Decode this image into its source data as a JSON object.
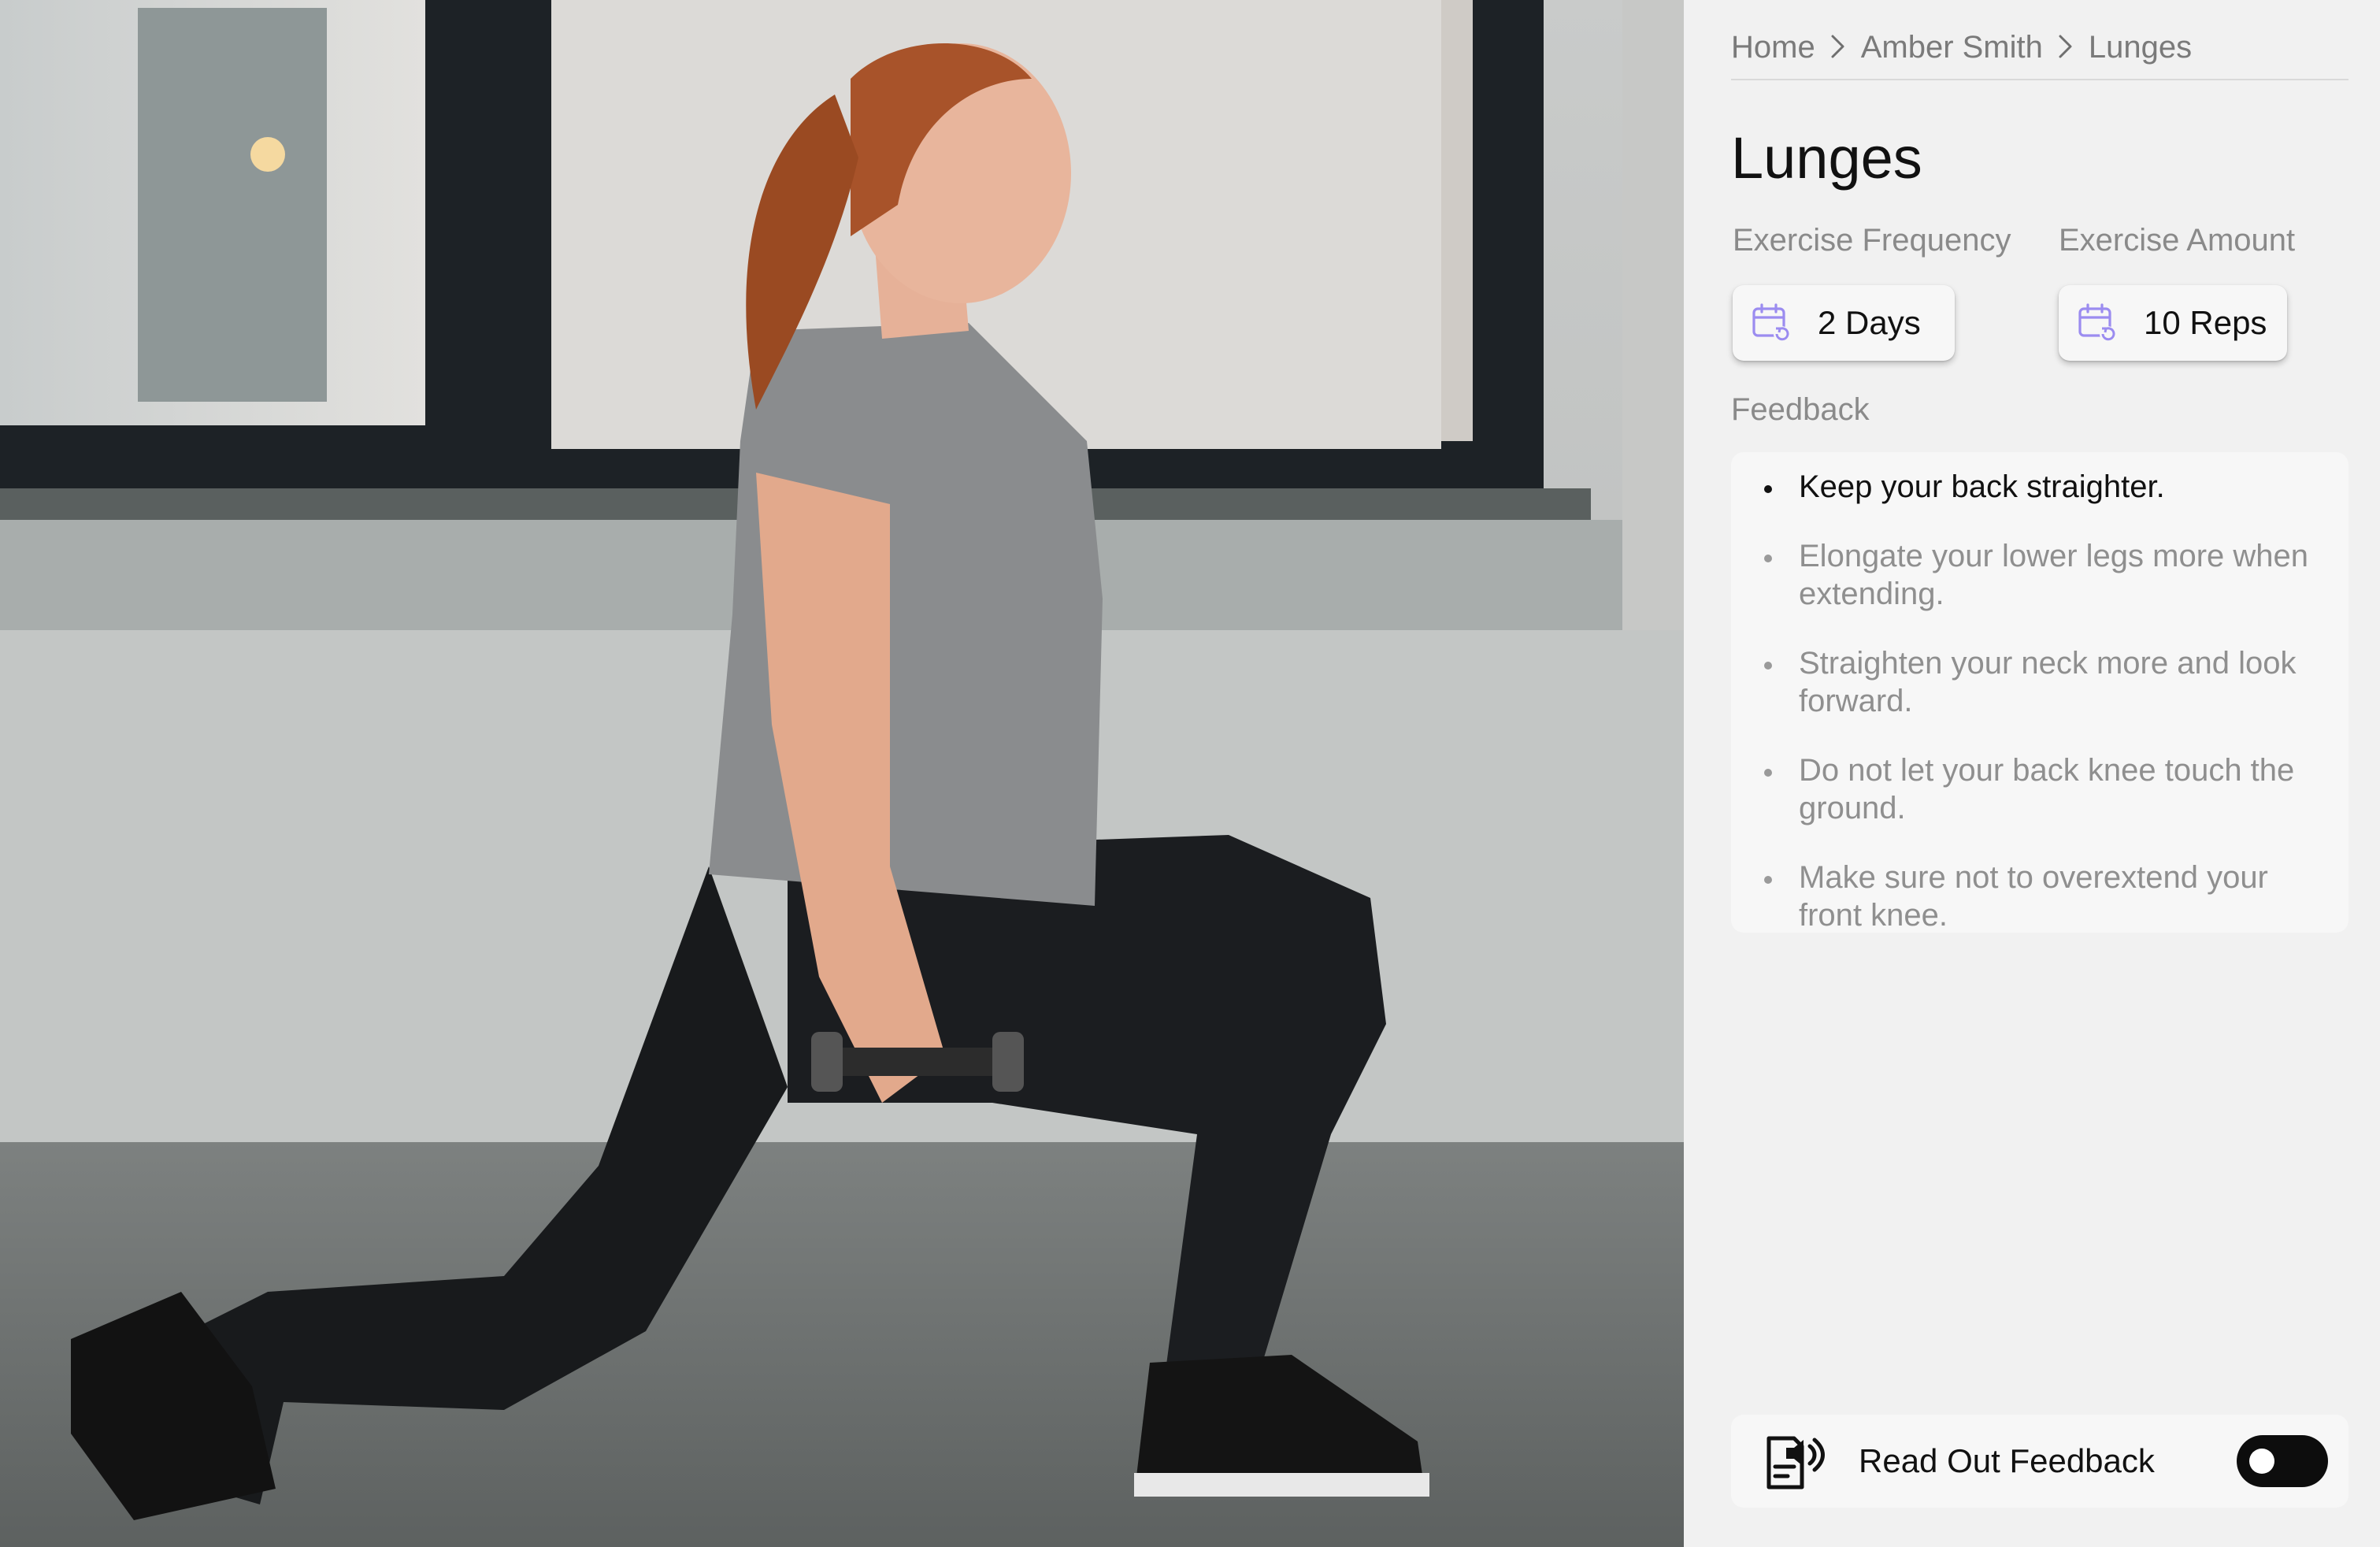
{
  "breadcrumb": {
    "items": [
      "Home",
      "Amber Smith",
      "Lunges"
    ]
  },
  "exercise": {
    "title": "Lunges",
    "frequency_label": "Exercise Frequency",
    "frequency_value": "2 Days",
    "amount_label": "Exercise Amount",
    "amount_value": "10 Reps"
  },
  "feedback": {
    "label": "Feedback",
    "items": [
      "Keep your back straighter.",
      "Elongate your lower legs more when extending.",
      "Straighten your neck more and look forward.",
      "Do not let your back knee touch the ground.",
      "Make sure not to overextend your front knee."
    ]
  },
  "readout": {
    "label": "Read Out Feedback",
    "toggle_on": false
  },
  "colors": {
    "accent_icon": "#9b8cf0",
    "panel_bg": "#f1f1f1",
    "card_bg": "#f7f7f7",
    "toggle_bg": "#0d0d0d"
  },
  "icons": {
    "frequency": "calendar-repeat-icon",
    "amount": "calendar-repeat-icon",
    "readout": "document-speaker-icon",
    "separator": "chevron-right-icon"
  }
}
